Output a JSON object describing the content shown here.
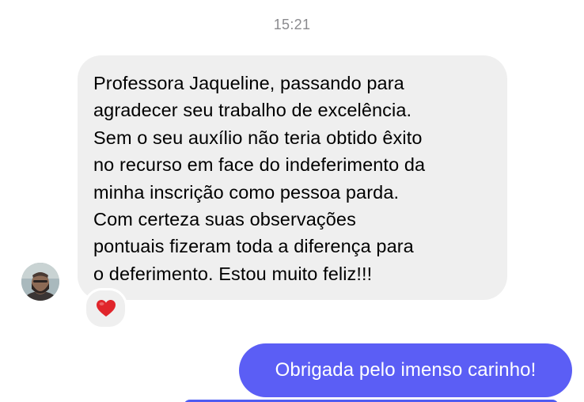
{
  "thread": {
    "timestamp": "15:21"
  },
  "incoming": {
    "avatar_icon": "person-avatar-icon",
    "text": "Professora Jaqueline, passando para\nagradecer seu trabalho de excelência.\nSem o seu auxílio não teria obtido êxito\nno recurso em face do indeferimento da\nminha inscrição como pessoa parda.\nCom certeza suas observações\npontuais fizeram toda a diferença para\no deferimento. Estou muito feliz!!!",
    "bubble_color": "#efefef",
    "reaction_icon": "red-heart-icon",
    "reaction_color": "#e0252b"
  },
  "outgoing": {
    "text": "Obrigada pelo imenso carinho!",
    "bubble_color": "#5b5ef5",
    "text_color": "#ffffff"
  }
}
